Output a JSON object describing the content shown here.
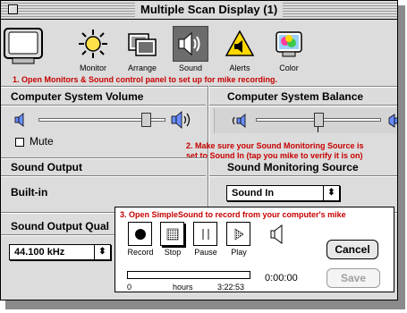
{
  "window": {
    "title": "Multiple Scan Display (1)"
  },
  "toolbar": {
    "items": [
      {
        "label": "Monitor",
        "icon": "sun-icon"
      },
      {
        "label": "Arrange",
        "icon": "arrange-icon"
      },
      {
        "label": "Sound",
        "icon": "speaker-icon",
        "selected": true
      },
      {
        "label": "Alerts",
        "icon": "alert-icon"
      },
      {
        "label": "Color",
        "icon": "color-icon"
      }
    ]
  },
  "annotations": {
    "step1": "1. Open Monitors & Sound control panel to set up for mike recording.",
    "step2_line1": "2. Make sure your Sound Monitoring Source is",
    "step2_line2": "set to Sound In (tap you mike to verify it is on)",
    "step3": "3. Open SimpleSound to record from your computer's mike"
  },
  "volume": {
    "heading": "Computer System Volume",
    "mute_label": "Mute",
    "mute_checked": false,
    "level": 0.88
  },
  "balance": {
    "heading": "Computer System Balance",
    "level": 0.5
  },
  "sound_output": {
    "heading": "Sound Output",
    "value": "Built-in"
  },
  "monitoring_source": {
    "heading": "Sound Monitoring Source",
    "selected": "Sound In"
  },
  "output_quality": {
    "heading": "Sound Output Qual",
    "selected": "44.100 kHz"
  },
  "simplesound": {
    "buttons": [
      {
        "label": "Record",
        "icon": "record-icon"
      },
      {
        "label": "Stop",
        "icon": "stop-icon"
      },
      {
        "label": "Pause",
        "icon": "pause-icon"
      },
      {
        "label": "Play",
        "icon": "play-icon"
      }
    ],
    "cancel_label": "Cancel",
    "save_label": "Save",
    "elapsed": "0:00:00",
    "scale_start": "0",
    "scale_unit": "hours",
    "scale_end": "3:22:53",
    "progress": 0
  },
  "colors": {
    "annotation": "#c80000",
    "window_bg": "#dcdcdc"
  }
}
